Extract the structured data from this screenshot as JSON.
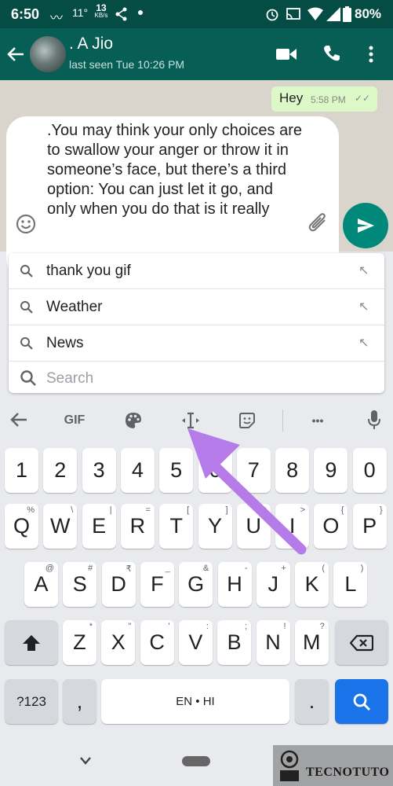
{
  "status_bar": {
    "time": "6:50",
    "temperature": "11°",
    "net_speed_value": "13",
    "net_speed_unit": "KB/s",
    "battery": "80%"
  },
  "chat_header": {
    "name": ". A Jio",
    "last_seen": "last seen Tue 10:26 PM"
  },
  "messages": {
    "outgoing": {
      "text": "Hey",
      "time": "5:58 PM",
      "ticks": "✓✓"
    }
  },
  "compose": {
    "text": ".You may think your only choices are to swallow your anger or throw it in someone’s face, but there’s a third option: You can just let it go, and only when you do that is it really"
  },
  "suggestions": {
    "items": [
      {
        "label": "thank you gif"
      },
      {
        "label": "Weather"
      },
      {
        "label": "News"
      }
    ],
    "search_placeholder": "Search"
  },
  "keyboard": {
    "toolbar": {
      "gif_label": "GIF",
      "more_label": "•••"
    },
    "number_row": [
      "1",
      "2",
      "3",
      "4",
      "5",
      "6",
      "7",
      "8",
      "9",
      "0"
    ],
    "row_q": [
      {
        "key": "Q",
        "hint": "%"
      },
      {
        "key": "W",
        "hint": "\\"
      },
      {
        "key": "E",
        "hint": "|"
      },
      {
        "key": "R",
        "hint": "="
      },
      {
        "key": "T",
        "hint": "["
      },
      {
        "key": "Y",
        "hint": "]"
      },
      {
        "key": "U",
        "hint": "<"
      },
      {
        "key": "I",
        "hint": ">"
      },
      {
        "key": "O",
        "hint": "{"
      },
      {
        "key": "P",
        "hint": "}"
      }
    ],
    "row_a": [
      {
        "key": "A",
        "hint": "@"
      },
      {
        "key": "S",
        "hint": "#"
      },
      {
        "key": "D",
        "hint": "₹"
      },
      {
        "key": "F",
        "hint": "_"
      },
      {
        "key": "G",
        "hint": "&"
      },
      {
        "key": "H",
        "hint": "-"
      },
      {
        "key": "J",
        "hint": "+"
      },
      {
        "key": "K",
        "hint": "("
      },
      {
        "key": "L",
        "hint": ")"
      }
    ],
    "row_z": [
      {
        "key": "Z",
        "hint": "*"
      },
      {
        "key": "X",
        "hint": "\""
      },
      {
        "key": "C",
        "hint": "'"
      },
      {
        "key": "V",
        "hint": ":"
      },
      {
        "key": "B",
        "hint": ";"
      },
      {
        "key": "N",
        "hint": "!"
      },
      {
        "key": "M",
        "hint": "?"
      }
    ],
    "symbols_label": "?123",
    "comma_label": ",",
    "space_label": "EN • HI",
    "period_label": "."
  },
  "watermark": {
    "text": "TECNOTUTO"
  },
  "colors": {
    "header": "#075e54",
    "status_bar": "#054d44",
    "accent": "#00897b",
    "annotation_arrow": "#b57be8",
    "key_blue": "#1a73e8"
  }
}
